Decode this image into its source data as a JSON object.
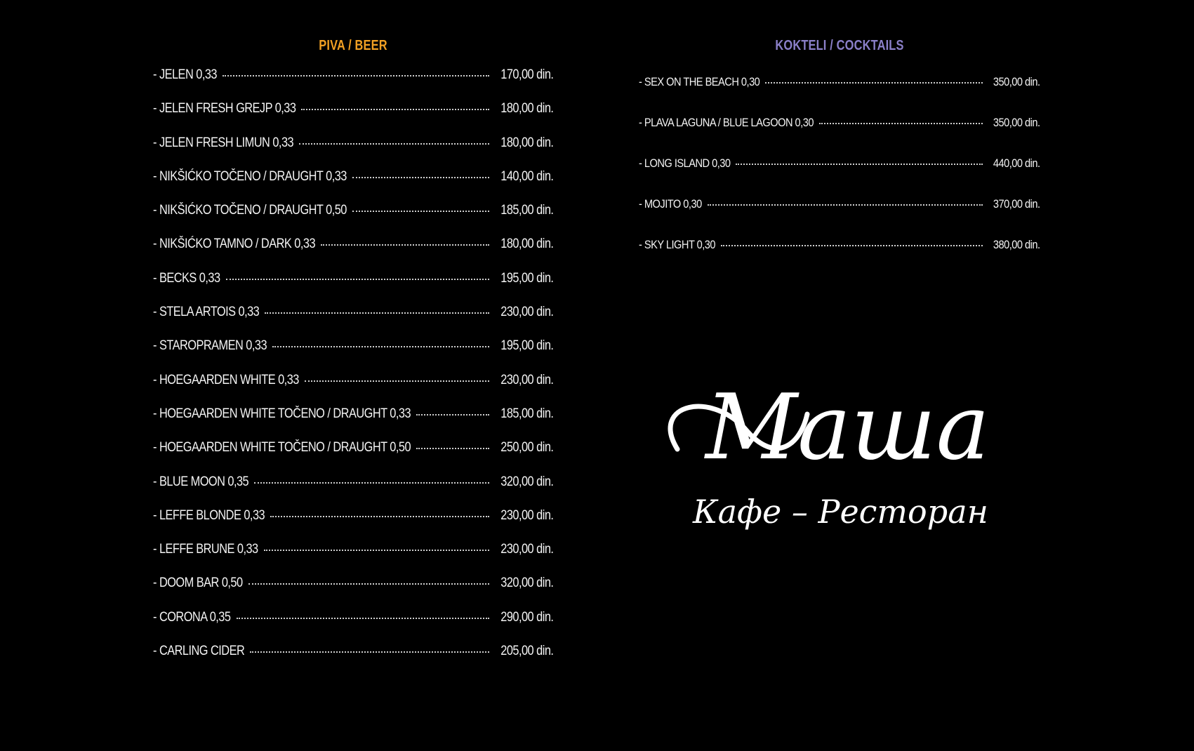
{
  "beer": {
    "title": "PIVA / BEER",
    "items": [
      {
        "name": "- JELEN 0,33",
        "price": "170,00 din."
      },
      {
        "name": "- JELEN FRESH GREJP 0,33",
        "price": "180,00 din."
      },
      {
        "name": "- JELEN FRESH LIMUN 0,33",
        "price": "180,00 din."
      },
      {
        "name": "- NIKŠIĆKO TOČENO / DRAUGHT 0,33",
        "price": "140,00 din."
      },
      {
        "name": "- NIKŠIĆKO TOČENO / DRAUGHT 0,50",
        "price": "185,00 din."
      },
      {
        "name": "- NIKŠIĆKO TAMNO / DARK 0,33",
        "price": "180,00 din."
      },
      {
        "name": "- BECKS 0,33",
        "price": "195,00 din."
      },
      {
        "name": "- STELA ARTOIS 0,33",
        "price": "230,00 din."
      },
      {
        "name": "- STAROPRAMEN 0,33",
        "price": "195,00 din."
      },
      {
        "name": "- HOEGAARDEN WHITE 0,33",
        "price": "230,00 din."
      },
      {
        "name": "- HOEGAARDEN WHITE TOČENO / DRAUGHT 0,33",
        "price": "185,00 din."
      },
      {
        "name": "- HOEGAARDEN WHITE TOČENO / DRAUGHT 0,50",
        "price": "250,00 din."
      },
      {
        "name": "- BLUE MOON 0,35",
        "price": "320,00 din."
      },
      {
        "name": "- LEFFE BLONDE 0,33",
        "price": "230,00 din."
      },
      {
        "name": "- LEFFE BRUNE 0,33",
        "price": "230,00 din."
      },
      {
        "name": "- DOOM BAR 0,50",
        "price": "320,00 din."
      },
      {
        "name": "- CORONA 0,35",
        "price": "290,00 din."
      },
      {
        "name": "- CARLING CIDER",
        "price": "205,00 din."
      }
    ]
  },
  "cocktails": {
    "title": "KOKTELI / COCKTAILS",
    "items": [
      {
        "name": "- SEX ON THE BEACH 0,30",
        "price": "350,00 din."
      },
      {
        "name": "- PLAVA LAGUNA / BLUE LAGOON 0,30",
        "price": "350,00 din."
      },
      {
        "name": "- LONG ISLAND 0,30",
        "price": "440,00 din."
      },
      {
        "name": "- MOJITO 0,30",
        "price": "370,00 din."
      },
      {
        "name": "- SKY LIGHT 0,30",
        "price": "380,00 din."
      }
    ]
  },
  "logo": {
    "name": "Маша",
    "tagline": "Кафе – Ресторан"
  },
  "colors": {
    "background": "#000000",
    "beer_title": "#f2a023",
    "cocktail_title": "#8b80c9",
    "text": "#ffffff"
  }
}
